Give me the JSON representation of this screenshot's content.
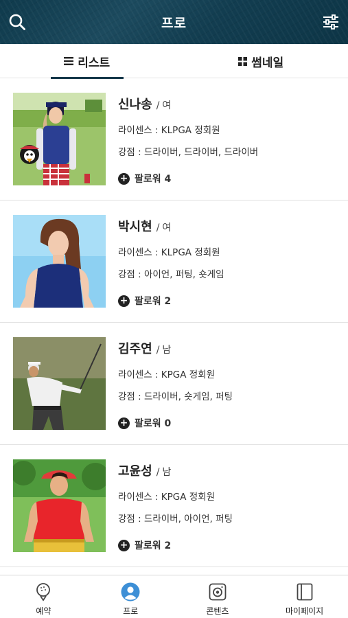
{
  "header": {
    "title": "프로",
    "left_icon": "search-icon",
    "right_icon": "filter-settings-icon"
  },
  "tabs": [
    {
      "label": "리스트",
      "icon": "list-icon",
      "active": true
    },
    {
      "label": "썸네일",
      "icon": "grid-icon",
      "active": false
    }
  ],
  "pros": [
    {
      "name": "신나송",
      "gender": "여",
      "license": "라이센스 : KLPGA 정회원",
      "strength": "강점 : 드라이버, 드라이버, 드라이버",
      "follow": "팔로워 4"
    },
    {
      "name": "박시현",
      "gender": "여",
      "license": "라이센스 : KLPGA 정회원",
      "strength": "강점 : 아이언, 퍼팅, 숏게임",
      "follow": "팔로워 2"
    },
    {
      "name": "김주연",
      "gender": "남",
      "license": "라이센스 : KPGA 정회원",
      "strength": "강점 : 드라이버, 숏게임, 퍼팅",
      "follow": "팔로워 0"
    },
    {
      "name": "고윤성",
      "gender": "남",
      "license": "라이센스 : KPGA 정회원",
      "strength": "강점 : 드라이버, 아이언, 퍼팅",
      "follow": "팔로워 2"
    }
  ],
  "separator": "/",
  "bottom_nav": [
    {
      "label": "예약",
      "icon": "golf-ball-icon",
      "active": false
    },
    {
      "label": "프로",
      "icon": "user-icon",
      "active": true
    },
    {
      "label": "콘텐츠",
      "icon": "camera-icon",
      "active": false
    },
    {
      "label": "마이페이지",
      "icon": "book-icon",
      "active": false
    }
  ],
  "colors": {
    "header_bg": "#15384a",
    "active_accent": "#3d8fd6",
    "text": "#222222"
  }
}
